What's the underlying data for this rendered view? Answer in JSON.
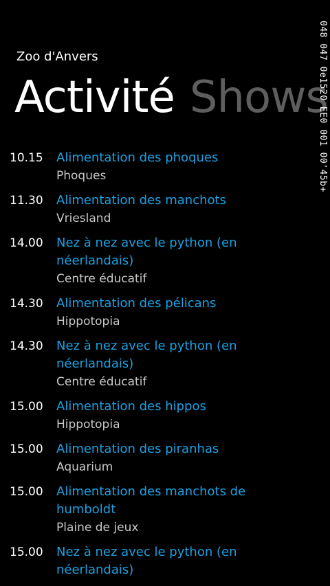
{
  "app": {
    "title": "Zoo d'Anvers"
  },
  "pivot": {
    "headers": [
      {
        "label": "Activité",
        "active": true
      },
      {
        "label": "Shows",
        "active": false
      }
    ]
  },
  "debug": {
    "counter_text": "048 047 0e1520 EE0 001 00'45b+"
  },
  "schedule": [
    {
      "time": "10.15",
      "title": "Alimentation des phoques",
      "location": "Phoques"
    },
    {
      "time": "11.30",
      "title": "Alimentation des manchots",
      "location": "Vriesland"
    },
    {
      "time": "14.00",
      "title": "Nez à nez avec le python (en néerlandais)",
      "location": "Centre éducatif"
    },
    {
      "time": "14.30",
      "title": "Alimentation des pélicans",
      "location": "Hippotopia"
    },
    {
      "time": "14.30",
      "title": "Nez à nez avec le python (en néerlandais)",
      "location": "Centre éducatif"
    },
    {
      "time": "15.00",
      "title": "Alimentation des hippos",
      "location": "Hippotopia"
    },
    {
      "time": "15.00",
      "title": "Alimentation des piranhas",
      "location": "Aquarium"
    },
    {
      "time": "15.00",
      "title": "Alimentation des manchots de humboldt",
      "location": "Plaine de jeux"
    },
    {
      "time": "15.00",
      "title": "Nez à nez avec le python (en néerlandais)",
      "location": ""
    }
  ],
  "colors": {
    "accent": "#1ba1e2",
    "background": "#000000",
    "inactive_header": "#5e5e5e",
    "subtext": "#c8c8c8"
  }
}
